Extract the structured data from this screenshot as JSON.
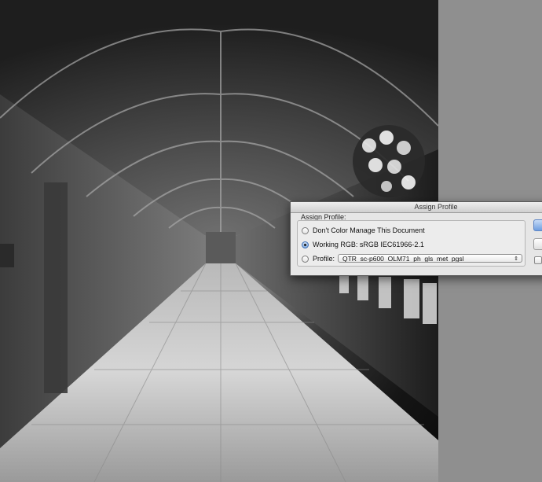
{
  "dialog": {
    "title": "Assign Profile",
    "group_label": "Assign Profile:",
    "options": [
      {
        "label": "Don't Color Manage This Document",
        "checked": false
      },
      {
        "label": "Working RGB:  sRGB IEC61966-2.1",
        "checked": true
      },
      {
        "label": "Profile:",
        "checked": false
      }
    ],
    "profile_select": {
      "value": "QTR_sc-p600_OLM71_ph_gls_met_pgsl",
      "arrow": "⇕"
    }
  },
  "colors": {
    "pasteboard": "#8f8f8f",
    "dialog_bg": "#e6e6e6",
    "accent": "#6e9ee0"
  },
  "icons": [
    "radio-icon",
    "select-arrow-icon",
    "checkbox-icon"
  ]
}
